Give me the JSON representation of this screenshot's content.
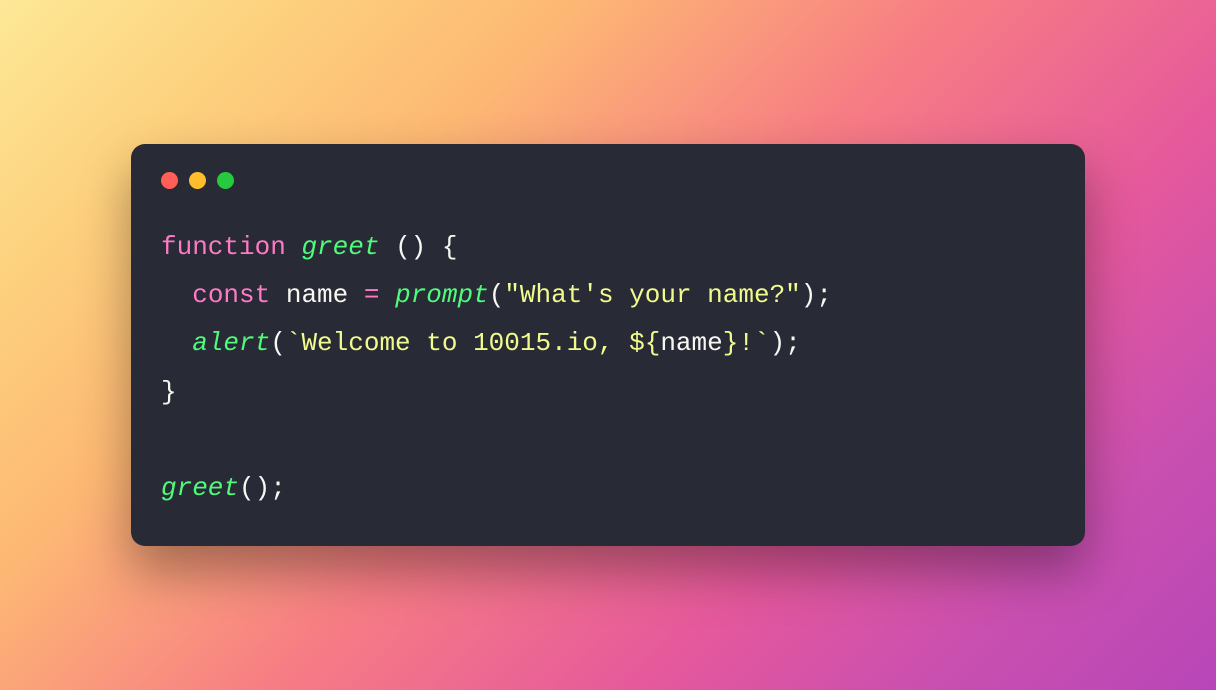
{
  "code": {
    "line1": {
      "kw_function": "function",
      "space1": " ",
      "fn_name": "greet",
      "space2": " ",
      "paren_open": "(",
      "paren_close": ")",
      "space3": " ",
      "brace_open": "{"
    },
    "line2": {
      "indent": "  ",
      "kw_const": "const",
      "space1": " ",
      "var_name": "name",
      "space2": " ",
      "equals": "=",
      "space3": " ",
      "fn_prompt": "prompt",
      "paren_open": "(",
      "str_literal": "\"What's your name?\"",
      "paren_close": ")",
      "semi": ";"
    },
    "line3": {
      "indent": "  ",
      "fn_alert": "alert",
      "paren_open": "(",
      "tpl_open": "`Welcome to 10015.io, ",
      "tpl_expr_open": "${",
      "tpl_var": "name",
      "tpl_expr_close": "}",
      "tpl_close": "!`",
      "paren_close": ")",
      "semi": ";"
    },
    "line4": {
      "brace_close": "}"
    },
    "line5": {
      "empty": ""
    },
    "line6": {
      "fn_call": "greet",
      "paren_open": "(",
      "paren_close": ")",
      "semi": ";"
    }
  },
  "colors": {
    "background": "#282a36",
    "keyword": "#ff79c6",
    "function": "#50fa7b",
    "string": "#f1fa8c",
    "default": "#f8f8f2"
  }
}
